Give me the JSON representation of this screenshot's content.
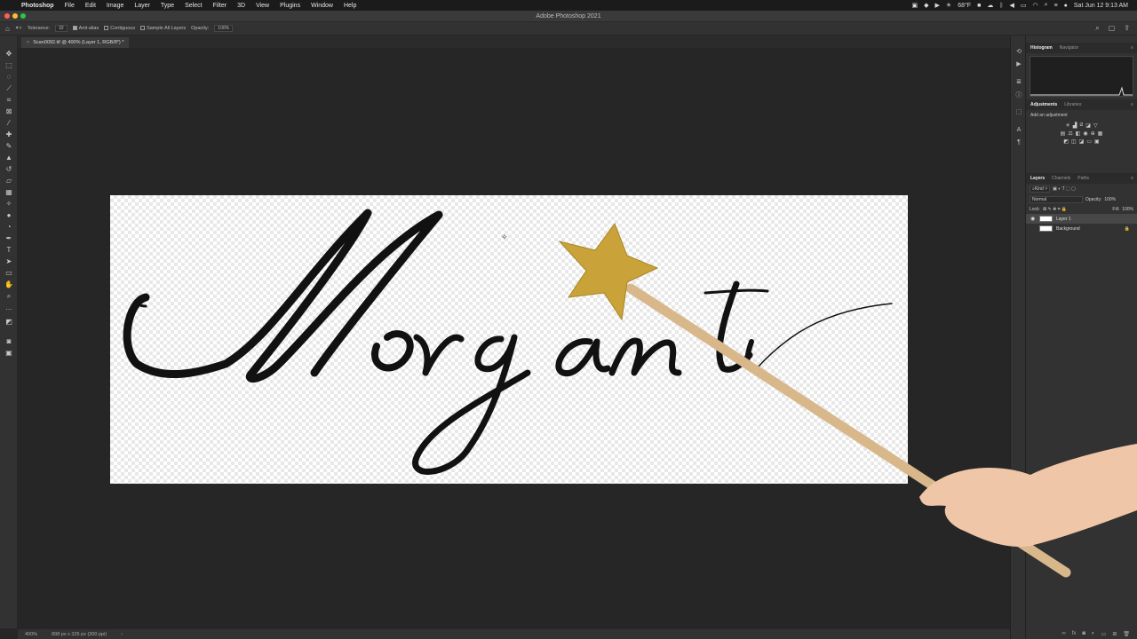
{
  "menubar": {
    "app": "Photoshop",
    "items": [
      "File",
      "Edit",
      "Image",
      "Layer",
      "Type",
      "Select",
      "Filter",
      "3D",
      "View",
      "Plugins",
      "Window",
      "Help"
    ],
    "temperature": "68°F",
    "datetime": "Sat Jun 12  9:13 AM"
  },
  "window": {
    "title": "Adobe Photoshop 2021"
  },
  "options": {
    "tolerance_label": "Tolerance:",
    "tolerance_value": "32",
    "anti_alias": "Anti-alias",
    "contiguous": "Contiguous",
    "sample_all_layers": "Sample All Layers",
    "opacity_label": "Opacity:",
    "opacity_value": "100%"
  },
  "document": {
    "tab_title": "Scan0092.tif @ 400% (Layer 1, RGB/8*) *",
    "script_text": "Morganti"
  },
  "status": {
    "zoom": "400%",
    "info": "898 px x 325 px (300 ppi)"
  },
  "panels": {
    "top_tabs": [
      "Histogram",
      "Navigator"
    ],
    "adj_tabs": [
      "Adjustments",
      "Libraries"
    ],
    "adj_title": "Add an adjustment",
    "layers_tabs": [
      "Layers",
      "Channels",
      "Paths"
    ],
    "kind": "Kind",
    "blend": "Normal",
    "opacity_label": "Opacity:",
    "opacity_value": "100%",
    "lock_label": "Lock:",
    "fill_label": "Fill:",
    "fill_value": "100%",
    "layers": [
      {
        "name": "Layer 1"
      },
      {
        "name": "Background"
      }
    ]
  },
  "colors": {
    "menubar": "#1b1b1b",
    "panel": "#323232",
    "canvas": "#262626",
    "star": "#c9a33a",
    "wand": "#d8b88a"
  }
}
